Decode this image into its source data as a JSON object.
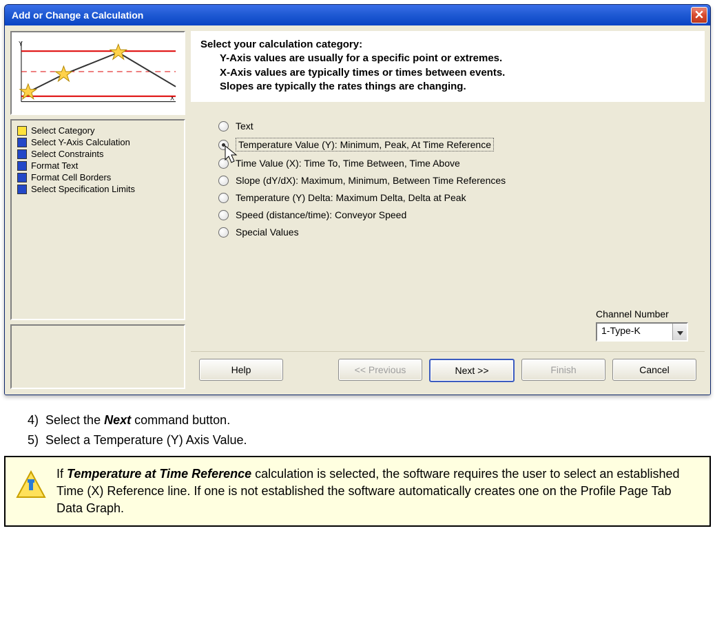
{
  "window": {
    "title": "Add or Change a Calculation"
  },
  "steps": [
    {
      "label": "Select Category",
      "active": true
    },
    {
      "label": "Select Y-Axis Calculation",
      "active": false
    },
    {
      "label": "Select Constraints",
      "active": false
    },
    {
      "label": "Format Text",
      "active": false
    },
    {
      "label": "Format Cell Borders",
      "active": false
    },
    {
      "label": "Select Specification Limits",
      "active": false
    }
  ],
  "header": {
    "title": "Select your calculation category:",
    "line1": "Y-Axis values are usually for a specific point or extremes.",
    "line2": "X-Axis values are typically times or times between events.",
    "line3": "Slopes are typically the rates things are changing."
  },
  "options": [
    "Text",
    "Temperature Value (Y):  Minimum, Peak, At Time Reference",
    "Time Value (X):  Time To, Time Between, Time Above",
    "Slope (dY/dX):  Maximum, Minimum, Between Time References",
    "Temperature (Y) Delta:  Maximum Delta, Delta at Peak",
    "Speed (distance/time): Conveyor Speed",
    "Special  Values"
  ],
  "selected_option_index": 1,
  "channel": {
    "label": "Channel Number",
    "value": "1-Type-K"
  },
  "buttons": {
    "help": "Help",
    "previous": "<< Previous",
    "next": "Next >>",
    "finish": "Finish",
    "cancel": "Cancel"
  },
  "instructions": {
    "step4_num": "4)",
    "step4_text_pre": "Select the ",
    "step4_bold": "Next",
    "step4_text_post": " command button.",
    "step5_num": "5)",
    "step5_text": "Select a Temperature (Y) Axis Value."
  },
  "note": {
    "pre": "If ",
    "bold": "Temperature at Time Reference",
    "post": " calculation is selected, the software requires the user to select an established Time (X) Reference line. If one is not established the software automatically creates one on the Profile Page Tab Data Graph."
  }
}
